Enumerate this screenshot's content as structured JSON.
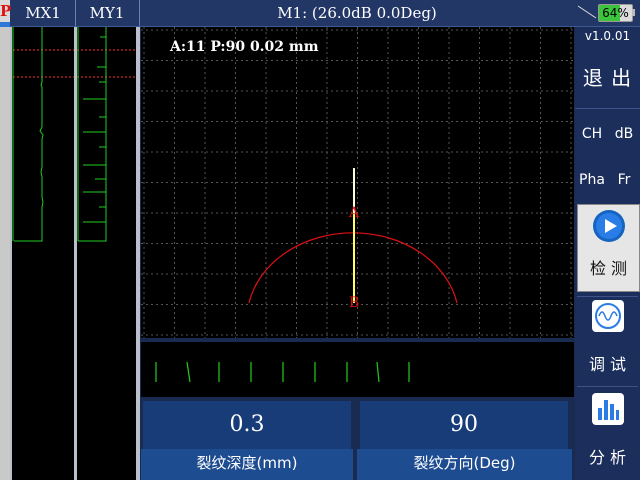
{
  "header": {
    "logo": "P",
    "channel_x": "MX1",
    "channel_y": "MY1",
    "title": "M1: (26.0dB 0.0Deg)",
    "battery": "64%"
  },
  "scope": {
    "readout": "A:11 P:90  0.02  mm",
    "marker_a": "A",
    "marker_b": "B"
  },
  "results": {
    "depth_value": "0.3",
    "depth_label": "裂纹深度(mm)",
    "direction_value": "90",
    "direction_label": "裂纹方向(Deg)"
  },
  "sidebar": {
    "version": "v1.0.01",
    "exit": "退 出",
    "ch": "CH",
    "db": "dB",
    "pha": "Pha",
    "fr": "Fr",
    "detect": "检 测",
    "debug": "调 试",
    "analyze": "分 析"
  },
  "colors": {
    "trace": "#22cc22",
    "cursor": "#ff2a2a",
    "signal": "#ffff66",
    "panel": "#1c2f5c"
  }
}
